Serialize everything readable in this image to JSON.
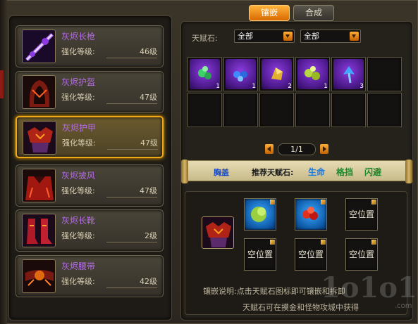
{
  "tabs": {
    "inlay": "镶嵌",
    "compose": "合成"
  },
  "filter": {
    "label": "天赋石:",
    "select1": "全部",
    "select2": "全部"
  },
  "equipment": [
    {
      "name": "灰烬长枪",
      "level_label": "强化等级:",
      "level": "46级",
      "icon": "spear-icon"
    },
    {
      "name": "灰烬护盔",
      "level_label": "强化等级:",
      "level": "47级",
      "icon": "helmet-icon"
    },
    {
      "name": "灰烬护甲",
      "level_label": "强化等级:",
      "level": "47级",
      "icon": "armor-icon",
      "selected": true
    },
    {
      "name": "灰烬披风",
      "level_label": "强化等级:",
      "level": "47级",
      "icon": "cloak-icon"
    },
    {
      "name": "灰烬长靴",
      "level_label": "强化等级:",
      "level": "2级",
      "icon": "boots-icon"
    },
    {
      "name": "灰烬腰带",
      "level_label": "强化等级:",
      "level": "42级",
      "icon": "belt-icon"
    }
  ],
  "stones": [
    {
      "icon": "green-crystal-icon",
      "count": "1",
      "color": "#3fd26a"
    },
    {
      "icon": "blue-crystal-icon",
      "count": "1",
      "color": "#3c8cff"
    },
    {
      "icon": "gold-crystal-icon",
      "count": "2",
      "color": "#e0b030"
    },
    {
      "icon": "yellowgreen-crystal-icon",
      "count": "1",
      "color": "#b8d840"
    },
    {
      "icon": "cyan-crystal-icon",
      "count": "3",
      "color": "#40a8ff"
    }
  ],
  "pager": {
    "text": "1/1"
  },
  "banner": {
    "name": "胸盖",
    "recommend": "推荐天赋石:",
    "v1": "生命",
    "v2": "格挡",
    "v3": "闪避"
  },
  "sockets": {
    "empty_label": "空位置"
  },
  "desc": {
    "line1": "镶嵌说明:点击天赋石图标即可镶嵌和拆卸",
    "line2": "天赋石可在摸金和怪物攻城中获得"
  },
  "watermark": {
    "main": "1o1o1",
    "domain": ".com"
  },
  "colors": {
    "accent": "#f0a818",
    "item_name": "#b26be4",
    "life": "#1a4ac0",
    "block": "#1a8a2a",
    "dodge": "#1a8a2a"
  }
}
